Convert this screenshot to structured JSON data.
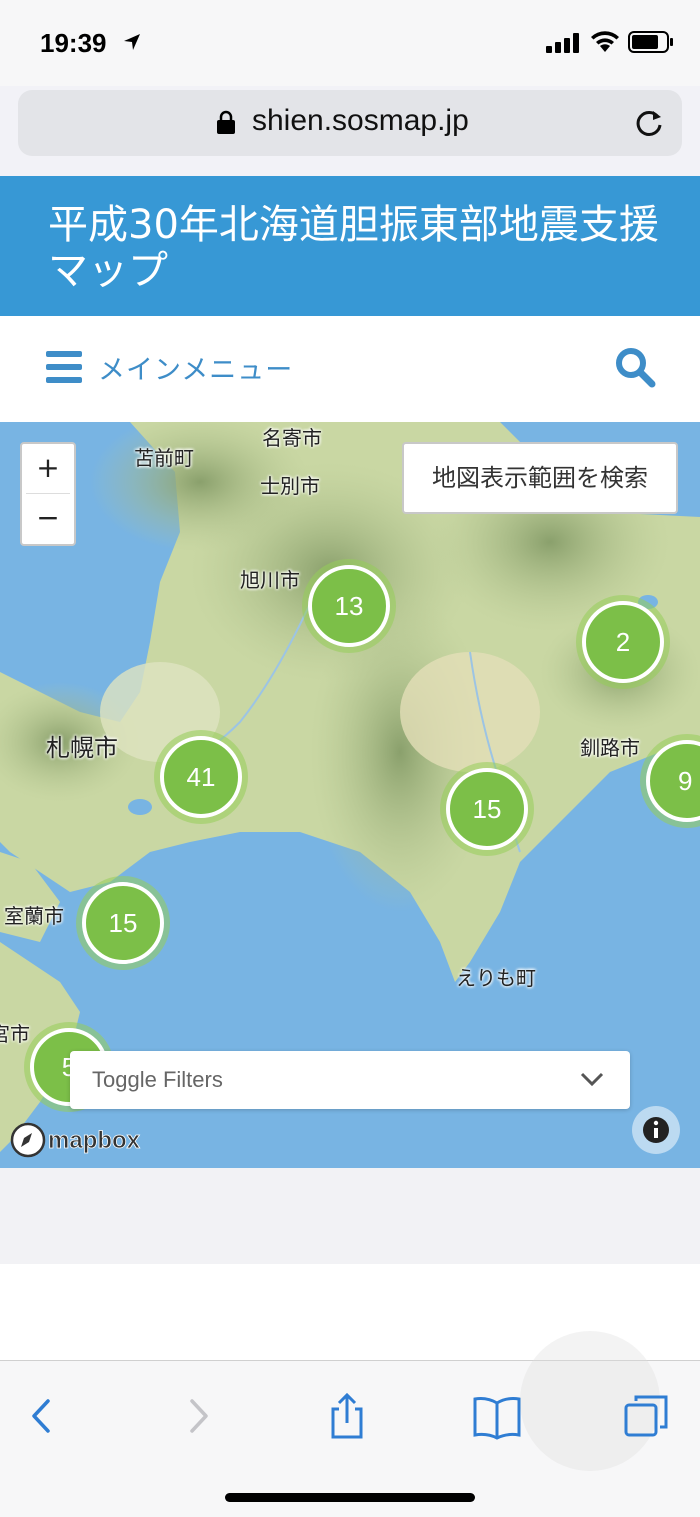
{
  "status_bar": {
    "time": "19:39"
  },
  "browser": {
    "url": "shien.sosmap.jp"
  },
  "site": {
    "title": "平成30年北海道胆振東部地震支援マップ",
    "menu_label": "メインメニュー"
  },
  "map": {
    "zoom_in": "+",
    "zoom_out": "−",
    "area_search_label": "地図表示範囲を検索",
    "toggle_filters_label": "Toggle Filters",
    "attribution": "mapbox",
    "place_labels": [
      "名寄市",
      "苫前町",
      "士別市",
      "旭川市",
      "札幌市",
      "釧路市",
      "室蘭市",
      "えりも町",
      "宮市"
    ],
    "clusters": [
      "13",
      "2",
      "41",
      "15",
      "9",
      "15",
      "5"
    ]
  },
  "colors": {
    "banner": "#3798d5",
    "accent": "#3e8dc8",
    "cluster": "#7cbf48",
    "sea": "#78b4e3",
    "land": "#c9d7a3"
  },
  "icons": [
    "location-arrow-icon",
    "signal-icon",
    "wifi-icon",
    "battery-icon",
    "lock-icon",
    "reload-icon",
    "hamburger-icon",
    "search-icon",
    "chevron-down-icon",
    "info-icon",
    "back-icon",
    "forward-icon",
    "share-icon",
    "bookmarks-icon",
    "tabs-icon"
  ]
}
